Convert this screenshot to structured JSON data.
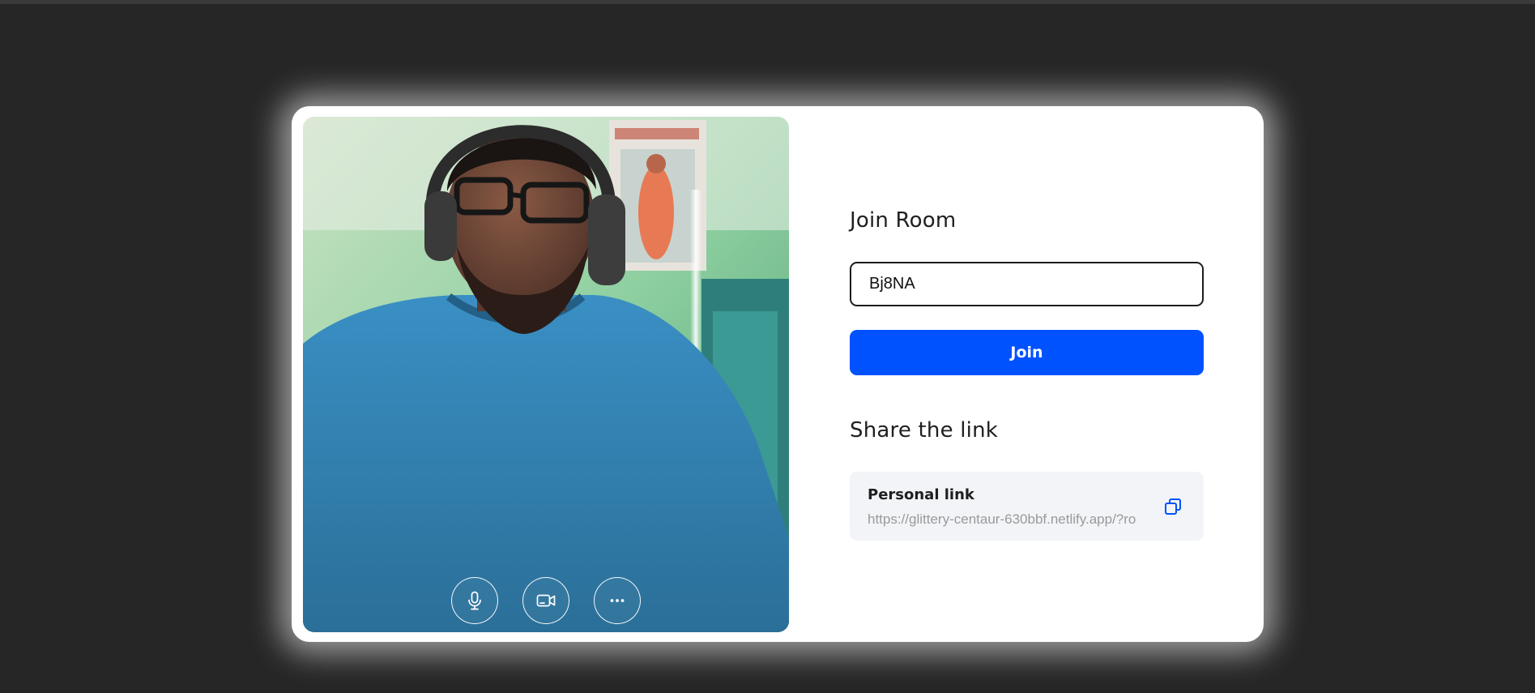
{
  "colors": {
    "page_background": "#262626",
    "card_background": "#ffffff",
    "accent": "#0052ff",
    "link_box_background": "#f3f4f8"
  },
  "preview": {
    "controls": [
      {
        "icon": "microphone-icon"
      },
      {
        "icon": "video-camera-icon"
      },
      {
        "icon": "more-options-icon"
      }
    ]
  },
  "join": {
    "title": "Join Room",
    "room_code": "Bj8NA",
    "button_label": "Join"
  },
  "share": {
    "title": "Share the link",
    "link_label": "Personal link",
    "link_url": "https://glittery-centaur-630bbf.netlify.app/?ro",
    "copy_icon": "copy-icon"
  }
}
